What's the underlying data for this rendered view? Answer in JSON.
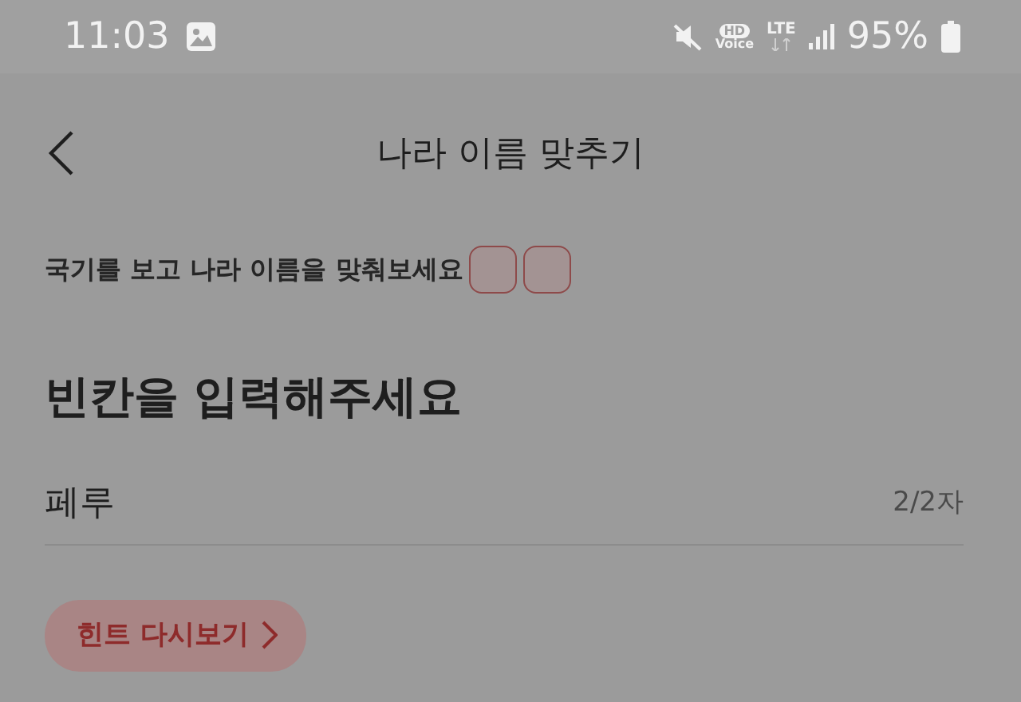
{
  "status_bar": {
    "time": "11:03",
    "hd_label": "HD",
    "voice_label": "Voice",
    "network": "LTE",
    "battery": "95%"
  },
  "header": {
    "title": "나라 이름 맞추기"
  },
  "instruction": {
    "text": "국기를 보고 나라 이름을 맞춰보세요",
    "answer_boxes": [
      {
        "filled": false
      },
      {
        "filled": false
      }
    ]
  },
  "heading": "빈칸을 입력해주세요",
  "answer": {
    "value": "페루",
    "counter": "2/2자"
  },
  "hint_button": {
    "label": "힌트 다시보기"
  }
}
